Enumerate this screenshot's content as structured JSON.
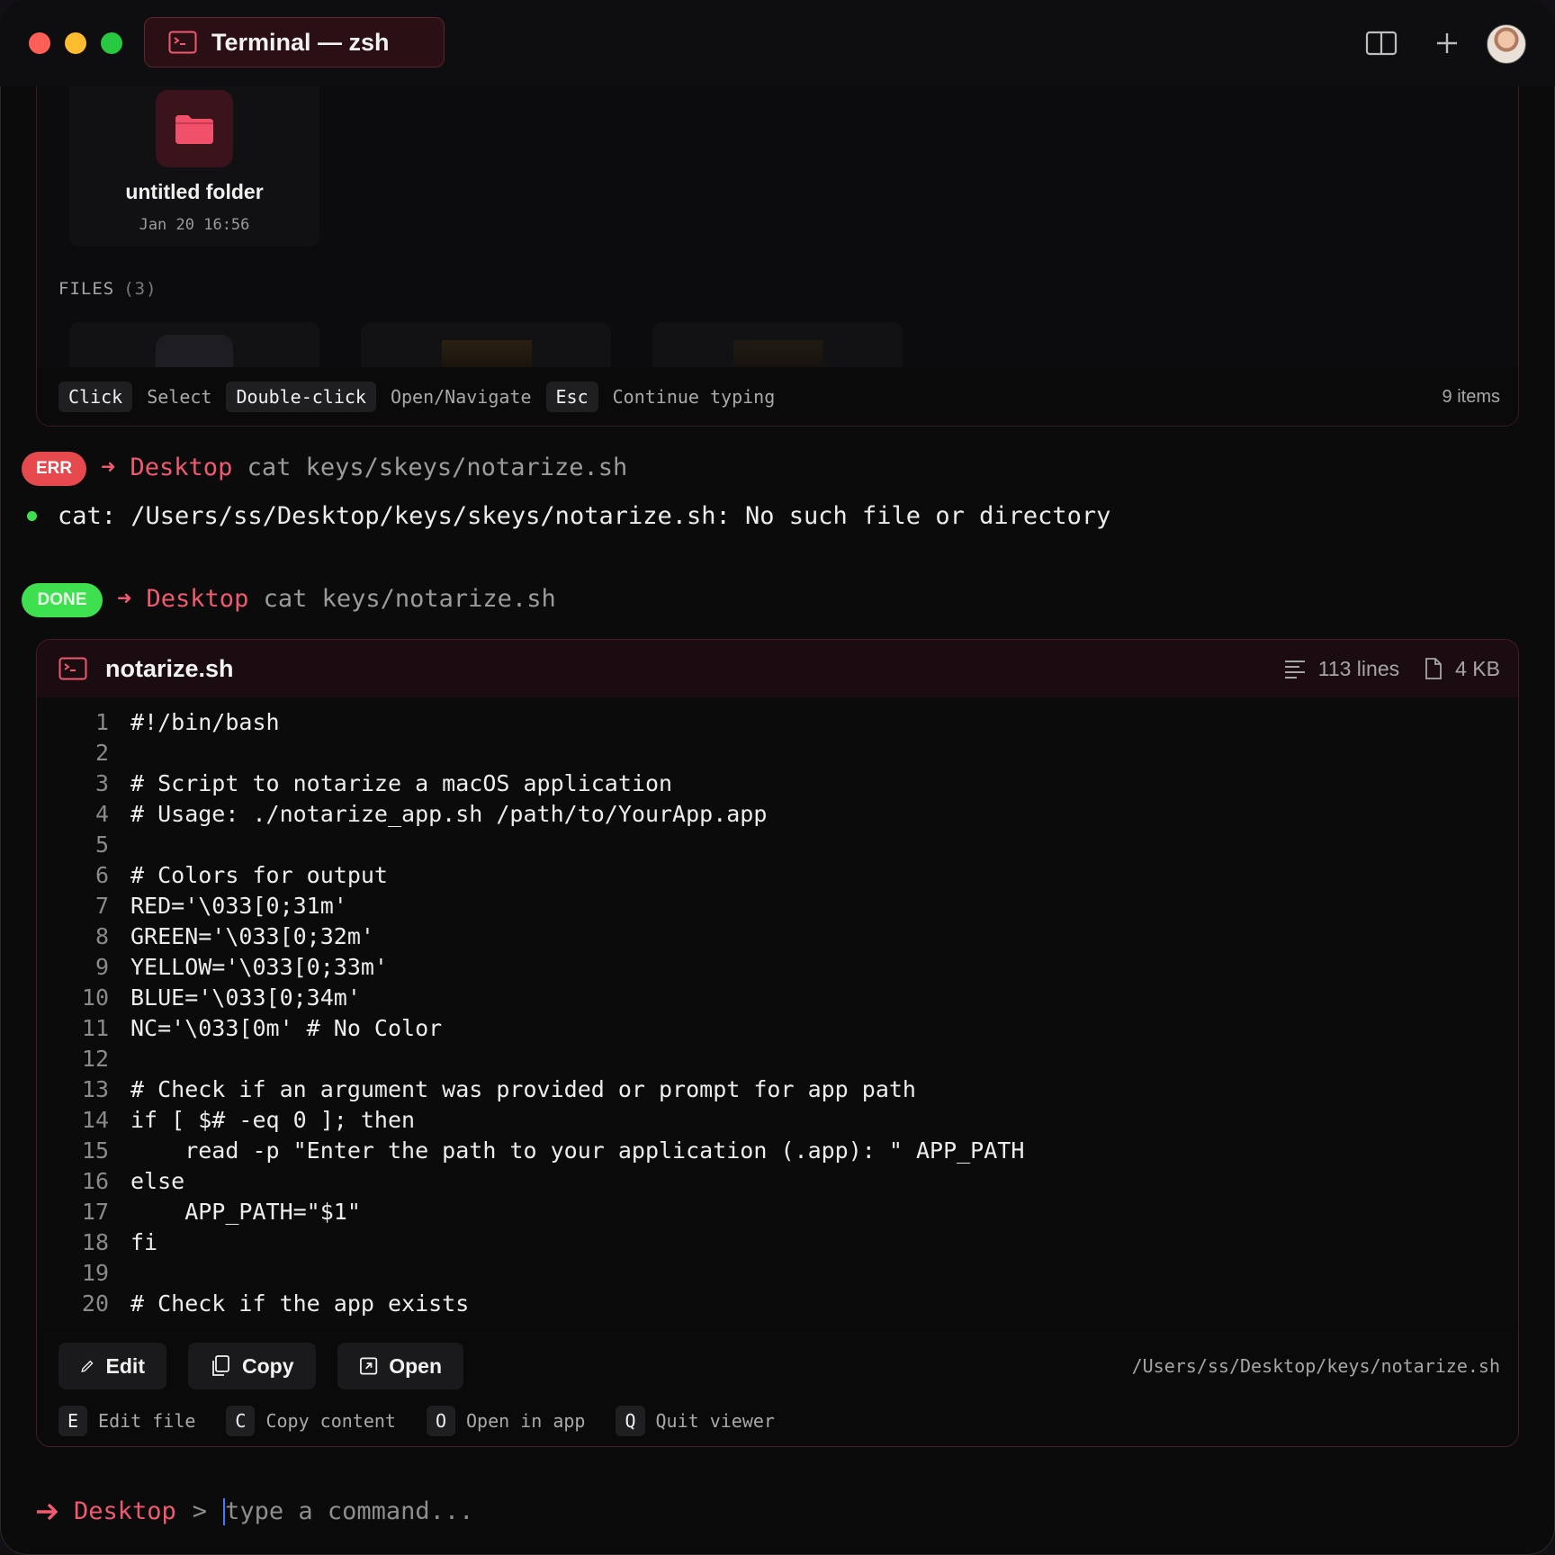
{
  "window": {
    "tab_title": "Terminal — zsh"
  },
  "finder": {
    "folder": {
      "name": "untitled folder",
      "date": "Jan 20 16:56"
    },
    "files_label": "FILES",
    "files_count": "(3)",
    "shortcuts": [
      {
        "key": "Click",
        "hint": "Select"
      },
      {
        "key": "Double-click",
        "hint": "Open/Navigate"
      },
      {
        "key": "Esc",
        "hint": "Continue typing"
      }
    ],
    "items_count": "9 items"
  },
  "history": [
    {
      "status": "ERR",
      "arrow": "➜",
      "dir": "Desktop",
      "command": "cat keys/skeys/notarize.sh",
      "output": "cat: /Users/ss/Desktop/keys/skeys/notarize.sh: No such file or directory"
    },
    {
      "status": "DONE",
      "arrow": "➜",
      "dir": "Desktop",
      "command": "cat keys/notarize.sh"
    }
  ],
  "viewer": {
    "filename": "notarize.sh",
    "lines_count": "113 lines",
    "size": "4 KB",
    "code": [
      {
        "n": "1",
        "t": "#!/bin/bash"
      },
      {
        "n": "2",
        "t": ""
      },
      {
        "n": "3",
        "t": "# Script to notarize a macOS application"
      },
      {
        "n": "4",
        "t": "# Usage: ./notarize_app.sh /path/to/YourApp.app"
      },
      {
        "n": "5",
        "t": ""
      },
      {
        "n": "6",
        "t": "# Colors for output"
      },
      {
        "n": "7",
        "t": "RED='\\033[0;31m'"
      },
      {
        "n": "8",
        "t": "GREEN='\\033[0;32m'"
      },
      {
        "n": "9",
        "t": "YELLOW='\\033[0;33m'"
      },
      {
        "n": "10",
        "t": "BLUE='\\033[0;34m'"
      },
      {
        "n": "11",
        "t": "NC='\\033[0m' # No Color"
      },
      {
        "n": "12",
        "t": ""
      },
      {
        "n": "13",
        "t": "# Check if an argument was provided or prompt for app path"
      },
      {
        "n": "14",
        "t": "if [ $# -eq 0 ]; then"
      },
      {
        "n": "15",
        "t": "    read -p \"Enter the path to your application (.app): \" APP_PATH"
      },
      {
        "n": "16",
        "t": "else"
      },
      {
        "n": "17",
        "t": "    APP_PATH=\"$1\""
      },
      {
        "n": "18",
        "t": "fi"
      },
      {
        "n": "19",
        "t": ""
      },
      {
        "n": "20",
        "t": "# Check if the app exists"
      }
    ],
    "buttons": {
      "edit": "Edit",
      "copy": "Copy",
      "open": "Open"
    },
    "path": "/Users/ss/Desktop/keys/notarize.sh",
    "shortcuts": [
      {
        "key": "E",
        "hint": "Edit file"
      },
      {
        "key": "C",
        "hint": "Copy content"
      },
      {
        "key": "O",
        "hint": "Open in app"
      },
      {
        "key": "Q",
        "hint": "Quit viewer"
      }
    ]
  },
  "prompt": {
    "arrow": "➜",
    "dir": "Desktop",
    "separator": ">",
    "placeholder": "type a command..."
  },
  "colors": {
    "accent": "#f05a70",
    "err": "#e5484d",
    "done": "#3ee04f",
    "caret": "#4a7bff"
  }
}
